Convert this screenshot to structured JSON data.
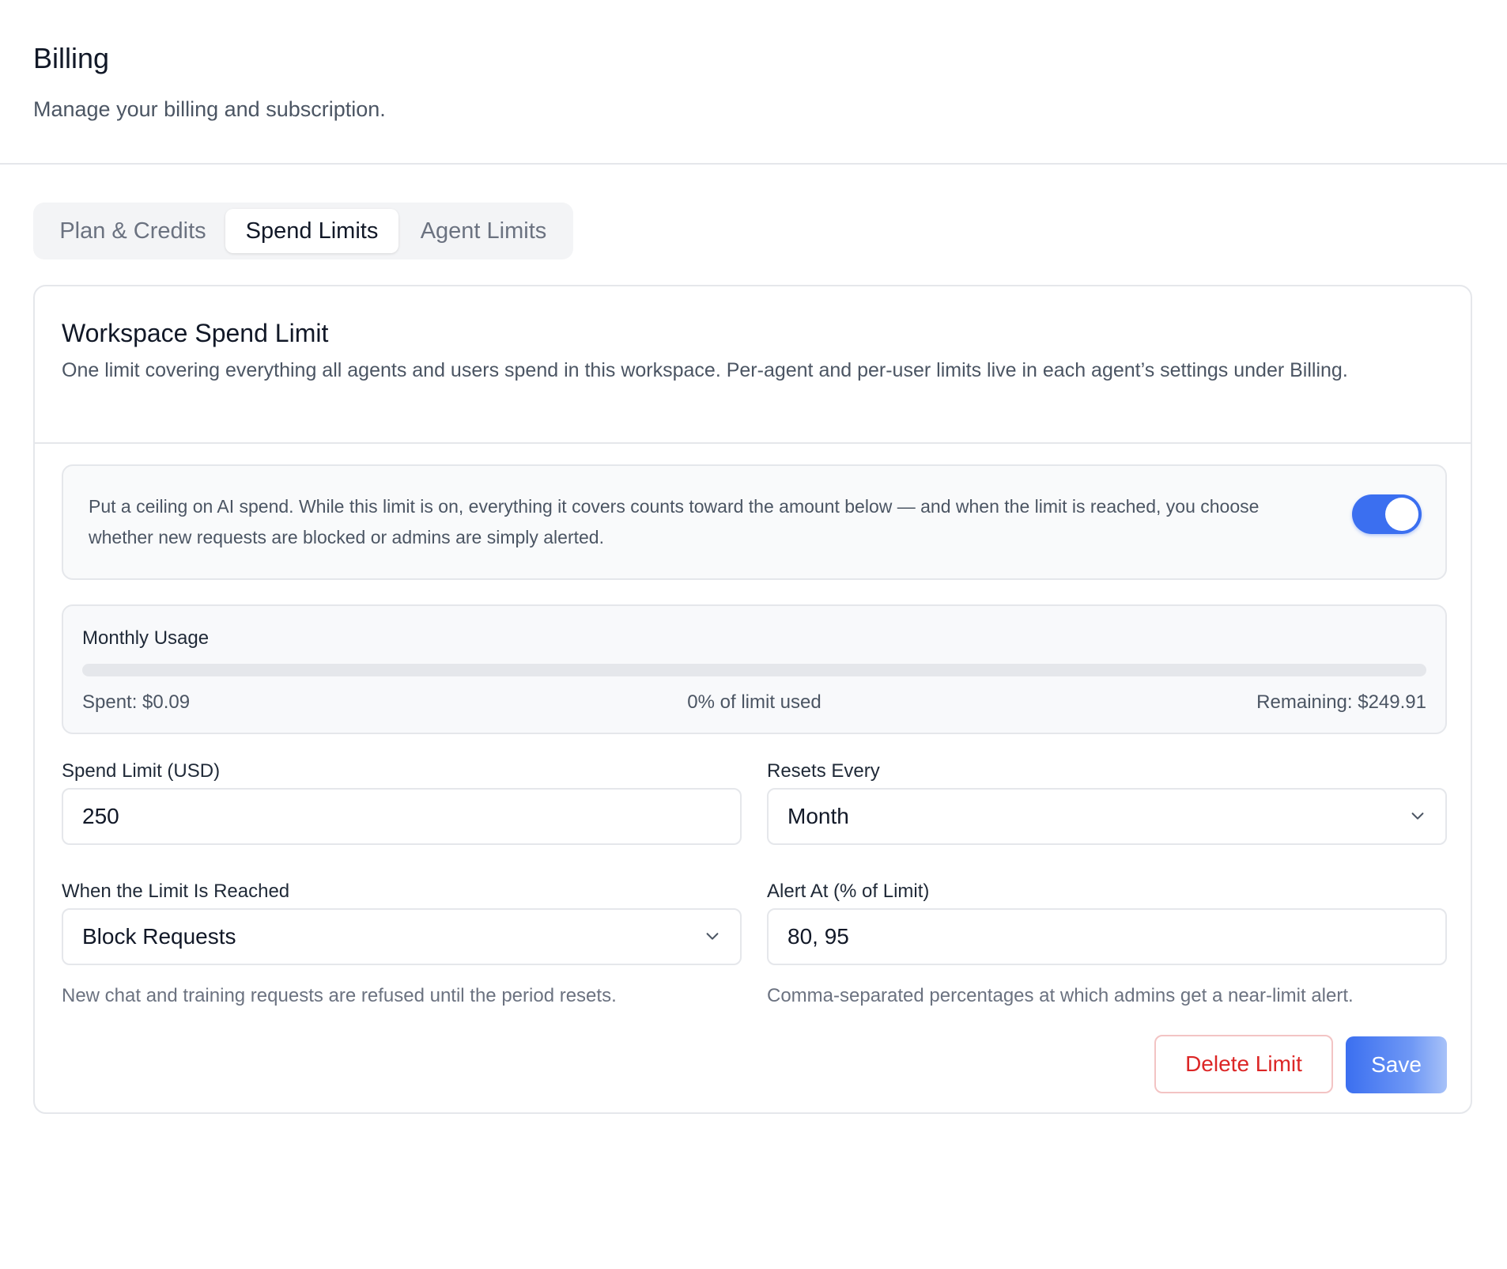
{
  "header": {
    "title": "Billing",
    "subtitle": "Manage your billing and subscription."
  },
  "tabs": [
    {
      "label": "Plan & Credits",
      "active": false
    },
    {
      "label": "Spend Limits",
      "active": true
    },
    {
      "label": "Agent Limits",
      "active": false
    }
  ],
  "card": {
    "title": "Workspace Spend Limit",
    "description": "One limit covering everything all agents and users spend in this workspace. Per-agent and per-user limits live in each agent’s settings under Billing."
  },
  "toggle_section": {
    "text": "Put a ceiling on AI spend. While this limit is on, everything it covers counts toward the amount below — and when the limit is reached, you choose whether new requests are blocked or admins are simply alerted.",
    "enabled": true
  },
  "usage": {
    "title": "Monthly Usage",
    "spent": "Spent: $0.09",
    "percent_text": "0% of limit used",
    "remaining": "Remaining: $249.91",
    "fill_fraction": 0.0
  },
  "form": {
    "spend_limit": {
      "label": "Spend Limit (USD)",
      "value": "250"
    },
    "resets_every": {
      "label": "Resets Every",
      "value": "Month"
    },
    "when_reached": {
      "label": "When the Limit Is Reached",
      "value": "Block Requests",
      "hint": "New chat and training requests are refused until the period resets."
    },
    "alert_at": {
      "label": "Alert At (% of Limit)",
      "value": "80, 95",
      "hint": "Comma-separated percentages at which admins get a near-limit alert."
    }
  },
  "buttons": {
    "delete_label": "Delete Limit",
    "save_label": "Save"
  },
  "colors": {
    "accent": "#3b6ff0",
    "danger": "#dc2626"
  }
}
